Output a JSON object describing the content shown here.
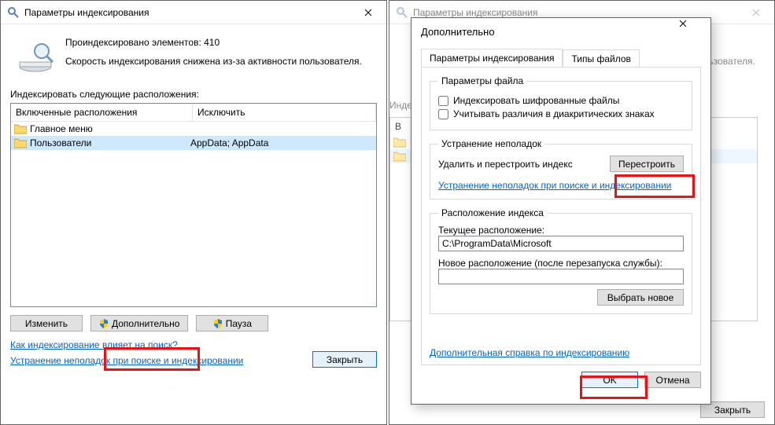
{
  "left": {
    "title": "Параметры индексирования",
    "indexed_line": "Проиндексировано элементов: 410",
    "speed_line": "Скорость индексирования снижена из-за активности пользователя.",
    "locations_label": "Индексировать следующие расположения:",
    "col_included": "Включенные расположения",
    "col_exclude": "Исключить",
    "rows": [
      {
        "name": "Главное меню",
        "exclude": ""
      },
      {
        "name": "Пользователи",
        "exclude": "AppData; AppData"
      }
    ],
    "btn_modify": "Изменить",
    "btn_advanced": "Дополнительно",
    "btn_pause": "Пауза",
    "link_how": "Как индексирование влияет на поиск?",
    "link_trouble": "Устранение неполадок при поиске и индексировании",
    "btn_close": "Закрыть"
  },
  "right_bg": {
    "title": "Параметры индексирования",
    "btn_close": "Закрыть"
  },
  "child": {
    "title": "Дополнительно",
    "tab1": "Параметры индексирования",
    "tab2": "Типы файлов",
    "grp_file": "Параметры файла",
    "chk_encrypted": "Индексировать шифрованные файлы",
    "chk_diacritics": "Учитывать различия в диакритических знаках",
    "grp_trouble": "Устранение неполадок",
    "trouble_text": "Удалить и перестроить индекс",
    "btn_rebuild": "Перестроить",
    "link_trouble": "Устранение неполадок при поиске и индексировании",
    "grp_loc": "Расположение индекса",
    "cur_label": "Текущее расположение:",
    "cur_value": "C:\\ProgramData\\Microsoft",
    "new_label": "Новое расположение (после перезапуска службы):",
    "btn_choose": "Выбрать новое",
    "link_help": "Дополнительная справка по индексированию",
    "ok": "OK",
    "cancel": "Отмена"
  }
}
